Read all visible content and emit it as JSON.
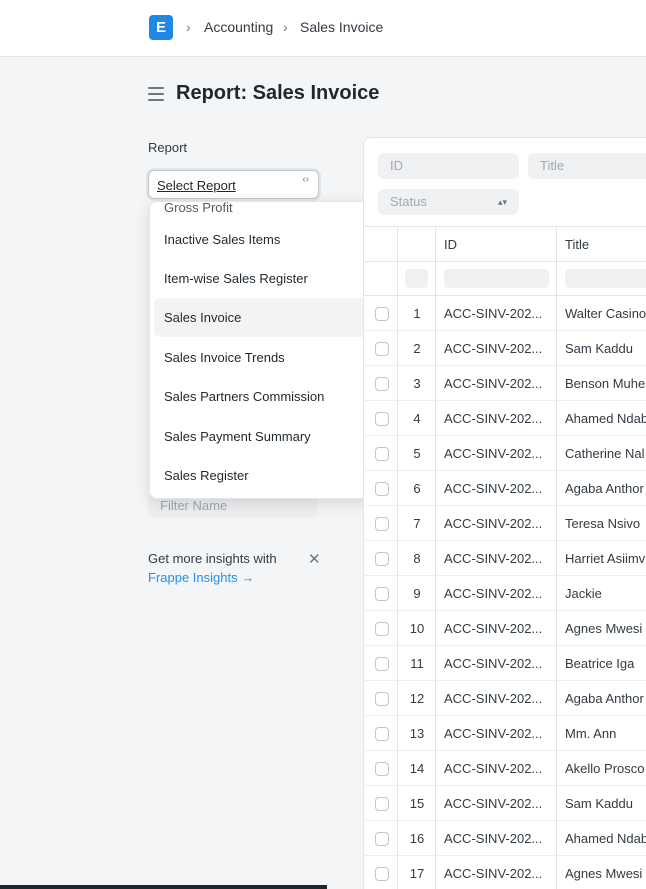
{
  "breadcrumb": {
    "logo_letter": "E",
    "items": [
      "Accounting",
      "Sales Invoice"
    ]
  },
  "page": {
    "title": "Report: Sales Invoice"
  },
  "sidebar": {
    "report_label": "Report",
    "report_select": "Select Report",
    "dropdown_items": [
      "Gross Profit",
      "Inactive Sales Items",
      "Item-wise Sales Register",
      "Sales Invoice",
      "Sales Invoice Trends",
      "Sales Partners Commission",
      "Sales Payment Summary",
      "Sales Register"
    ],
    "dropdown_active": "Sales Invoice",
    "filter_name_placeholder": "Filter Name",
    "insights_text": "Get more insights with",
    "insights_link": "Frappe Insights →"
  },
  "filters": {
    "id_placeholder": "ID",
    "title_placeholder": "Title",
    "status_placeholder": "Status"
  },
  "grid": {
    "columns": [
      "ID",
      "Title"
    ],
    "rows": [
      {
        "n": "1",
        "id": "ACC-SINV-202...",
        "title": "Walter Casino"
      },
      {
        "n": "2",
        "id": "ACC-SINV-202...",
        "title": "Sam Kaddu"
      },
      {
        "n": "3",
        "id": "ACC-SINV-202...",
        "title": "Benson Muhe"
      },
      {
        "n": "4",
        "id": "ACC-SINV-202...",
        "title": "Ahamed Ndab"
      },
      {
        "n": "5",
        "id": "ACC-SINV-202...",
        "title": "Catherine Nal"
      },
      {
        "n": "6",
        "id": "ACC-SINV-202...",
        "title": "Agaba Anthor"
      },
      {
        "n": "7",
        "id": "ACC-SINV-202...",
        "title": "Teresa Nsivo"
      },
      {
        "n": "8",
        "id": "ACC-SINV-202...",
        "title": "Harriet Asiimv"
      },
      {
        "n": "9",
        "id": "ACC-SINV-202...",
        "title": "Jackie"
      },
      {
        "n": "10",
        "id": "ACC-SINV-202...",
        "title": "Agnes Mwesi"
      },
      {
        "n": "11",
        "id": "ACC-SINV-202...",
        "title": "Beatrice Iga"
      },
      {
        "n": "12",
        "id": "ACC-SINV-202...",
        "title": "Agaba Anthor"
      },
      {
        "n": "13",
        "id": "ACC-SINV-202...",
        "title": "Mm. Ann"
      },
      {
        "n": "14",
        "id": "ACC-SINV-202...",
        "title": "Akello Prosco"
      },
      {
        "n": "15",
        "id": "ACC-SINV-202...",
        "title": "Sam Kaddu"
      },
      {
        "n": "16",
        "id": "ACC-SINV-202...",
        "title": "Ahamed Ndab"
      },
      {
        "n": "17",
        "id": "ACC-SINV-202...",
        "title": "Agnes Mwesi"
      }
    ]
  },
  "colors": {
    "accent": "#2490ef",
    "logo": "#1e88e5"
  }
}
